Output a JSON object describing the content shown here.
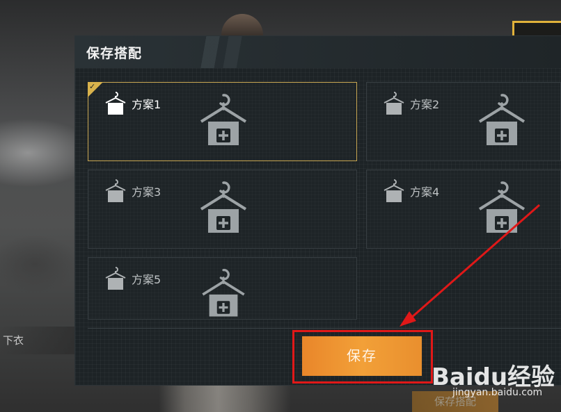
{
  "dialog": {
    "title": "保存搭配",
    "slots": [
      {
        "label": "方案1",
        "selected": true
      },
      {
        "label": "方案2",
        "selected": false
      },
      {
        "label": "方案3",
        "selected": false
      },
      {
        "label": "方案4",
        "selected": false
      },
      {
        "label": "方案5",
        "selected": false
      }
    ],
    "save_label": "保存"
  },
  "background": {
    "left_tag": "下衣",
    "bottom_button": "保存搭配"
  },
  "watermark": {
    "brand": "Baidu经验",
    "url": "jingyan.baidu.com"
  },
  "colors": {
    "accent_gold": "#d8b24c",
    "save_orange": "#f2a038",
    "annotation_red": "#e01818"
  },
  "icons": {
    "slot_tag": "shirt-hanger-tag-icon",
    "slot_add": "hanger-plus-icon",
    "check": "check-icon"
  }
}
